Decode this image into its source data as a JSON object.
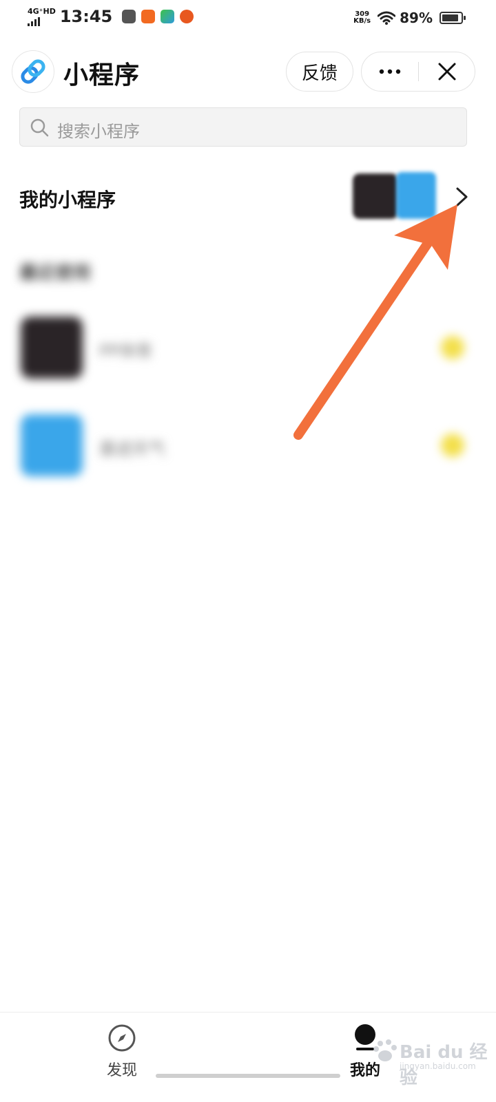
{
  "status_bar": {
    "network": "4G⁺HD",
    "time": "13:45",
    "speed_value": "309",
    "speed_unit": "KB/s",
    "battery_percent": "89%",
    "battery_level": 0.89
  },
  "header": {
    "title": "小程序",
    "feedback_label": "反馈",
    "logo_icon": "mini-program-link-icon",
    "accent_color": "#2b8be6"
  },
  "search": {
    "placeholder": "搜索小程序"
  },
  "my_programs": {
    "title": "我的小程序",
    "chevron_icon": "chevron-right-icon"
  },
  "recent": {
    "heading": "最近使用",
    "items": [
      {
        "name": "PP体育",
        "icon_color": "#2a2427",
        "starred": true
      },
      {
        "name": "墨迹天气",
        "icon_color": "#3aa6ea",
        "starred": true
      }
    ]
  },
  "annotation": {
    "color": "#f2703c"
  },
  "bottom_nav": {
    "items": [
      {
        "label": "发现",
        "icon": "compass-icon",
        "active": false
      },
      {
        "label": "我的",
        "icon": "person-icon",
        "active": true
      }
    ]
  },
  "watermark": {
    "text": "Bai du 经验",
    "url": "jingyan.baidu.com"
  }
}
